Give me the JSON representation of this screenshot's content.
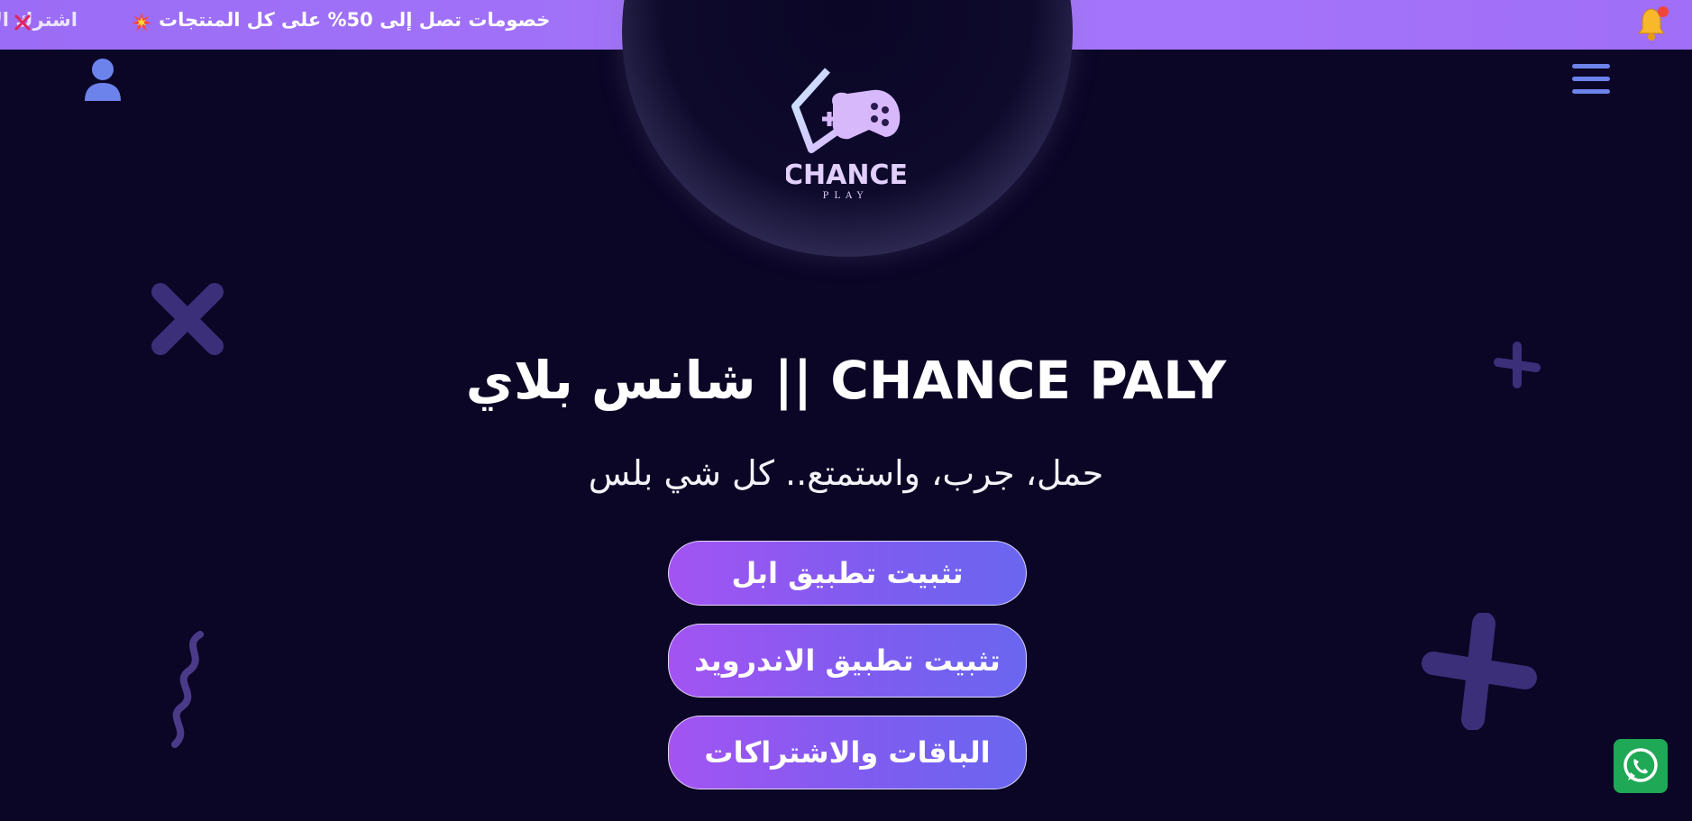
{
  "promo": {
    "text": "خصومات تصل إلى 50% على كل المنتجات",
    "next_text": "اشترك الآن",
    "icons": [
      "burst-icon",
      "close-icon",
      "bell-icon"
    ]
  },
  "header": {
    "icons": [
      "user-icon",
      "menu-icon"
    ]
  },
  "logo": {
    "word": "CHANCE",
    "subword": "PLAY"
  },
  "hero": {
    "title": "شانس بلاي || CHANCE PALY",
    "subtitle": "حمل، جرب، واستمتع.. كل شي بلس"
  },
  "buttons": {
    "install_apple": "تثبيت تطبيق ابل",
    "install_android": "تثبيت تطبيق الاندرويد",
    "plans": "الباقات والاشتراكات"
  },
  "colors": {
    "background": "#0b0626",
    "promo_bar": "#a576fb",
    "button_gradient_start": "#a354f2",
    "button_gradient_end": "#6a66f0",
    "icon_blue": "#6c83ec",
    "whatsapp_green": "#1fa855"
  },
  "floating": {
    "icon": "whatsapp-icon"
  }
}
